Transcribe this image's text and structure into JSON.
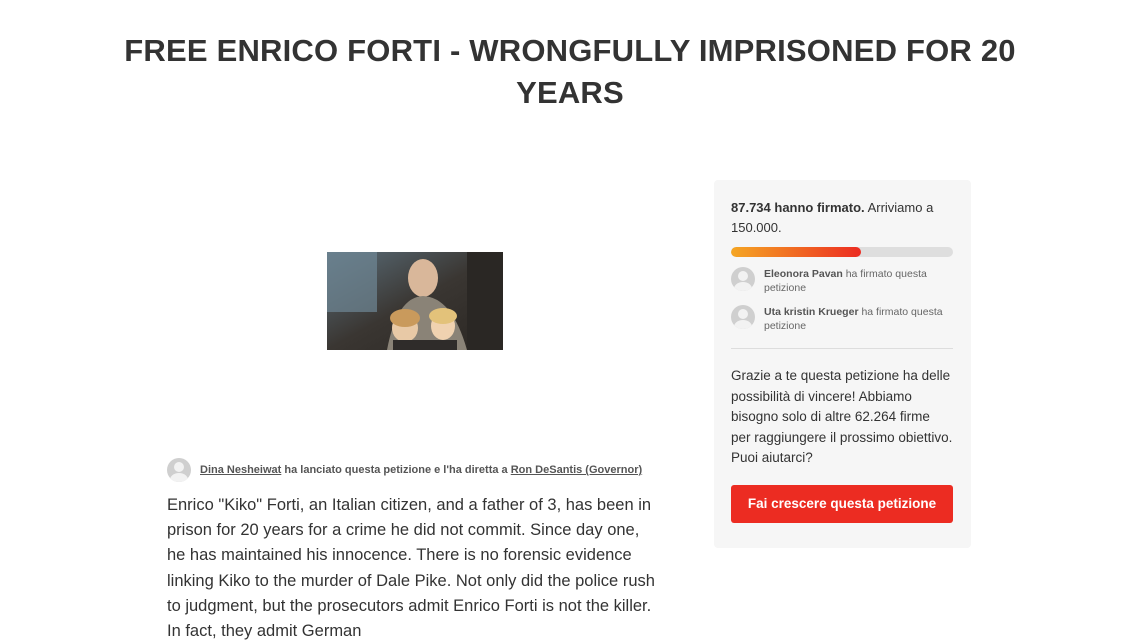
{
  "petition": {
    "title": "FREE ENRICO FORTI - WRONGFULLY IMPRISONED FOR 20 YEARS",
    "image_alt": "Enrico Forti with two children"
  },
  "starter": {
    "name": "Dina Nesheiwat",
    "action_text": "ha lanciato questa petizione e l'ha diretta a",
    "target": "Ron DeSantis (Governor)"
  },
  "body": {
    "text": "Enrico \"Kiko\" Forti, an Italian citizen, and a father of 3, has been in prison for 20 years for a crime he did not commit. Since day one, he has maintained his innocence. There is no forensic evidence linking Kiko to the murder of Dale Pike. Not only did the police rush to judgment, but the prosecutors admit Enrico Forti is not the killer. In fact, they admit German"
  },
  "sidebar": {
    "signed_count": "87.734 hanno firmato.",
    "goal_text": "Arriviamo a 150.000.",
    "progress_fraction": 0.585,
    "signers": [
      {
        "name": "Eleonora Pavan",
        "action": "ha firmato questa petizione"
      },
      {
        "name": "Uta kristin Krueger",
        "action": "ha firmato questa petizione"
      }
    ],
    "cta_text": "Grazie a te questa petizione ha delle possibilità di vincere! Abbiamo bisogno solo di altre 62.264 firme per raggiungere il prossimo obiettivo. Puoi aiutarci?",
    "cta_button": "Fai crescere questa petizione"
  },
  "colors": {
    "accent": "#ec2c22",
    "progress_start": "#f5a623",
    "panel_bg": "#f6f6f6"
  }
}
